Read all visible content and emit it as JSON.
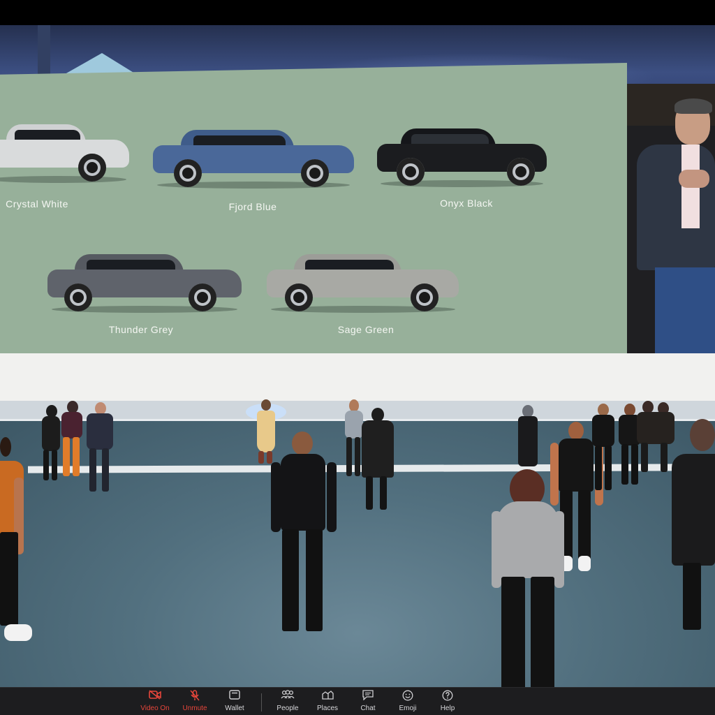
{
  "screen": {
    "car_colors": [
      {
        "label": "Crystal White",
        "paint": "#d9dbdc"
      },
      {
        "label": "Fjord Blue",
        "paint": "#4a6899"
      },
      {
        "label": "Onyx Black",
        "paint": "#1b1c1f"
      },
      {
        "label": "Thunder Grey",
        "paint": "#5f636b"
      },
      {
        "label": "Sage Green",
        "paint": "#a8a9a4"
      }
    ]
  },
  "toolbar": {
    "items": [
      {
        "label": "Video On",
        "icon": "video-off-icon",
        "state": "alert"
      },
      {
        "label": "Unmute",
        "icon": "mic-off-icon",
        "state": "alert"
      },
      {
        "label": "Wallet",
        "icon": "wallet-icon"
      },
      {
        "label": "People",
        "icon": "people-icon"
      },
      {
        "label": "Places",
        "icon": "places-icon"
      },
      {
        "label": "Chat",
        "icon": "chat-icon"
      },
      {
        "label": "Emoji",
        "icon": "emoji-icon"
      },
      {
        "label": "Help",
        "icon": "help-icon"
      }
    ]
  },
  "colors": {
    "screen_bg": "#97b09a",
    "alert_red": "#e8463b",
    "toolbar_bg": "#1d1d1f"
  }
}
